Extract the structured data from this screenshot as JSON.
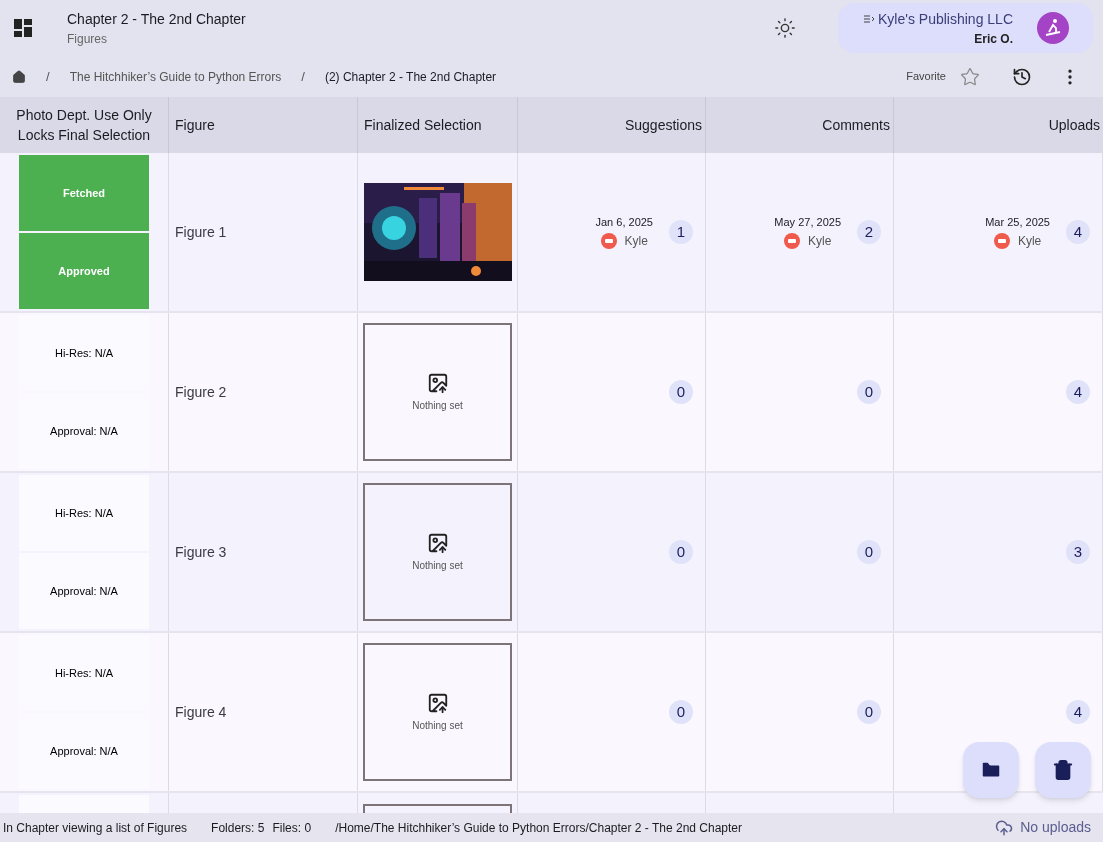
{
  "header": {
    "title": "Chapter 2 - The 2nd Chapter",
    "subtitle": "Figures",
    "account": {
      "company": "Kyle's Publishing LLC",
      "user": "Eric O."
    }
  },
  "breadcrumb": [
    {
      "separator": "/",
      "label": "The Hitchhiker’s Guide to Python Errors"
    },
    {
      "separator": "/",
      "label": "(2) Chapter 2 - The 2nd Chapter"
    }
  ],
  "actions": {
    "favorite_label": "Favorite",
    "favorite": false
  },
  "table": {
    "columns": [
      "Photo Dept. Use Only Locks Final Selection",
      "Figure",
      "Finalized Selection",
      "Suggestions",
      "Comments",
      "Uploads"
    ],
    "rows": [
      {
        "status": [
          {
            "text": "Fetched",
            "done": true
          },
          {
            "text": "Approved",
            "done": true
          }
        ],
        "figure": "Figure 1",
        "selection": {
          "kind": "picture"
        },
        "counts": [
          {
            "count": "1",
            "date": "Jan 6, 2025",
            "user": "Kyle"
          },
          {
            "count": "2",
            "date": "May 27, 2025",
            "user": "Kyle"
          },
          {
            "count": "4",
            "date": "Mar 25, 2025",
            "user": "Kyle"
          }
        ]
      },
      {
        "status": [
          {
            "text": "Hi-Res: N/A",
            "done": false
          },
          {
            "text": "Approval: N/A",
            "done": false
          }
        ],
        "figure": "Figure 2",
        "selection": {
          "kind": "empty",
          "text": "Nothing set"
        },
        "counts": [
          {
            "count": "0"
          },
          {
            "count": "0"
          },
          {
            "count": "4"
          }
        ]
      },
      {
        "status": [
          {
            "text": "Hi-Res: N/A",
            "done": false
          },
          {
            "text": "Approval: N/A",
            "done": false
          }
        ],
        "figure": "Figure 3",
        "selection": {
          "kind": "empty",
          "text": "Nothing set"
        },
        "counts": [
          {
            "count": "0"
          },
          {
            "count": "0"
          },
          {
            "count": "3"
          }
        ]
      },
      {
        "status": [
          {
            "text": "Hi-Res: N/A",
            "done": false
          },
          {
            "text": "Approval: N/A",
            "done": false
          }
        ],
        "figure": "Figure 4",
        "selection": {
          "kind": "empty",
          "text": "Nothing set"
        },
        "counts": [
          {
            "count": "0"
          },
          {
            "count": "0"
          },
          {
            "count": "4"
          }
        ]
      }
    ]
  },
  "status_bar": {
    "context": "In Chapter viewing a list of Figures",
    "folders": "Folders: 5",
    "files": "Files: 0",
    "path": "/Home/The Hitchhiker’s Guide to Python Errors/Chapter 2 - The 2nd Chapter",
    "uploads": "No uploads"
  }
}
